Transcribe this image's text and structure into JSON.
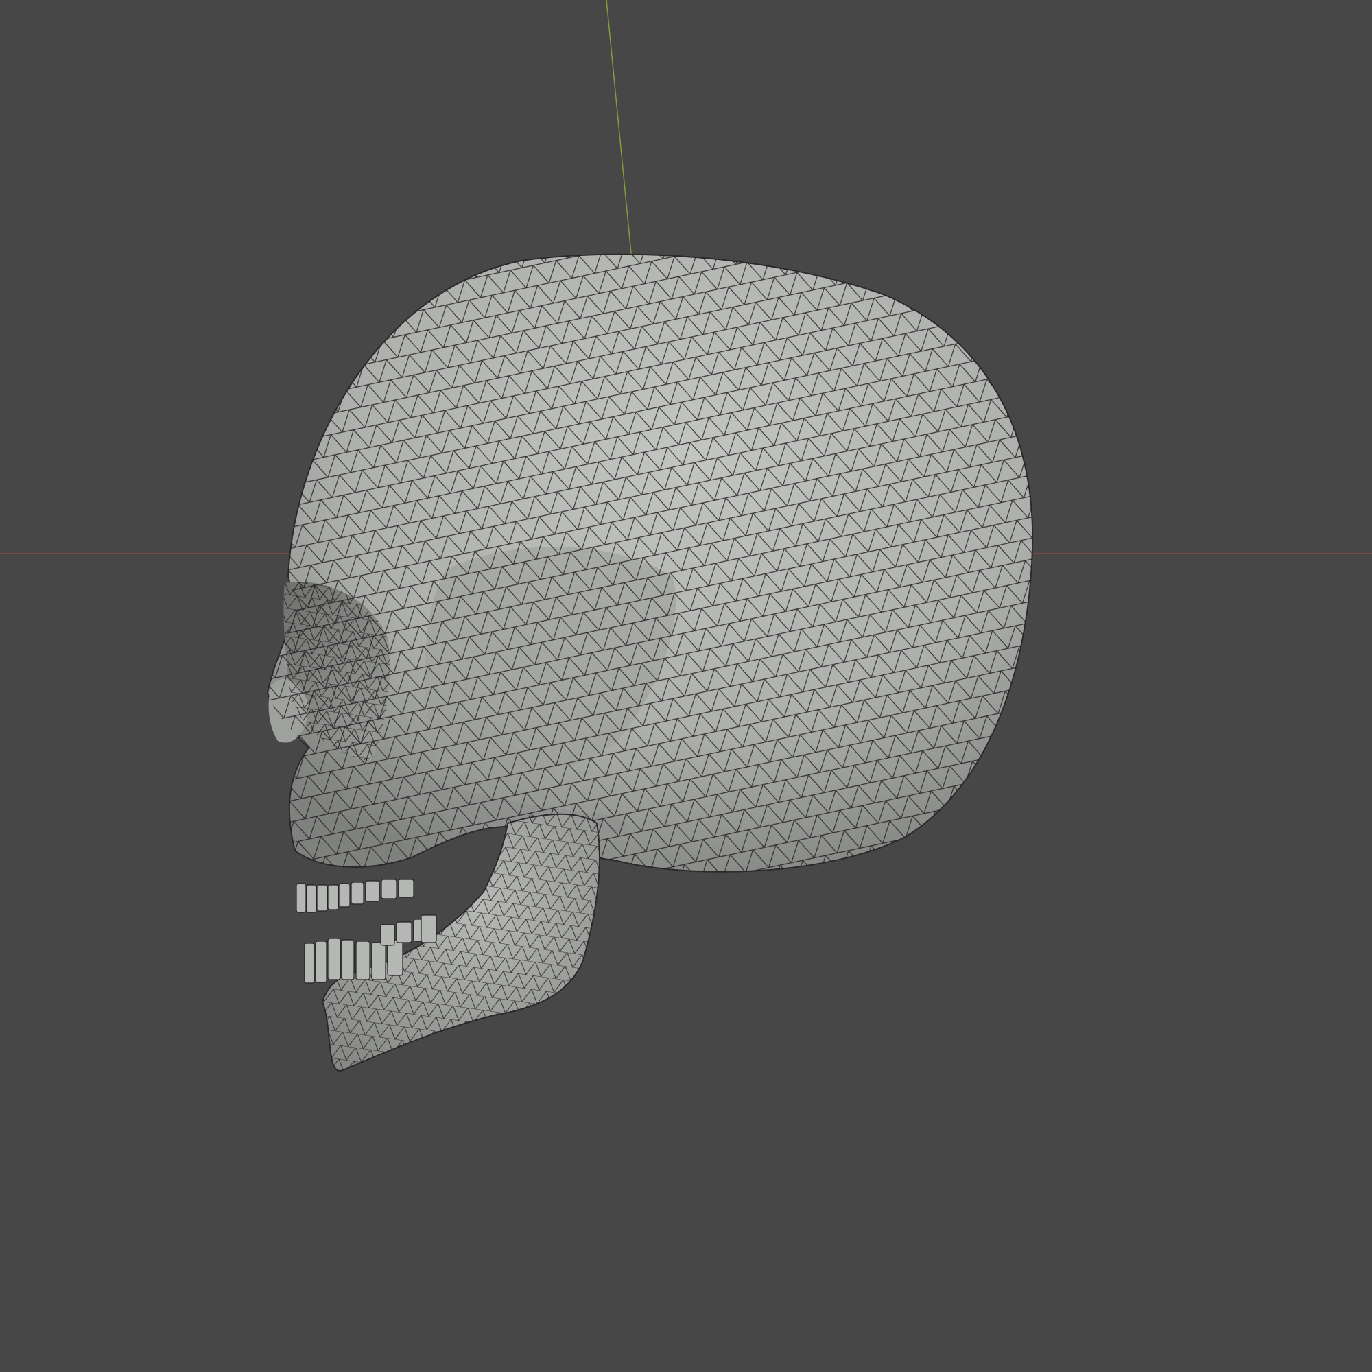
{
  "viewport": {
    "background_color": "#474747",
    "object_color": "#a9aba8",
    "wire_color": "#1c1c1c",
    "x_axis_color": "#8a4a43",
    "y_axis_color": "#7f9e3c",
    "shading": "solid-with-wireframe"
  },
  "object": {
    "name": "skull-mesh",
    "description_icon": "skull-icon"
  }
}
